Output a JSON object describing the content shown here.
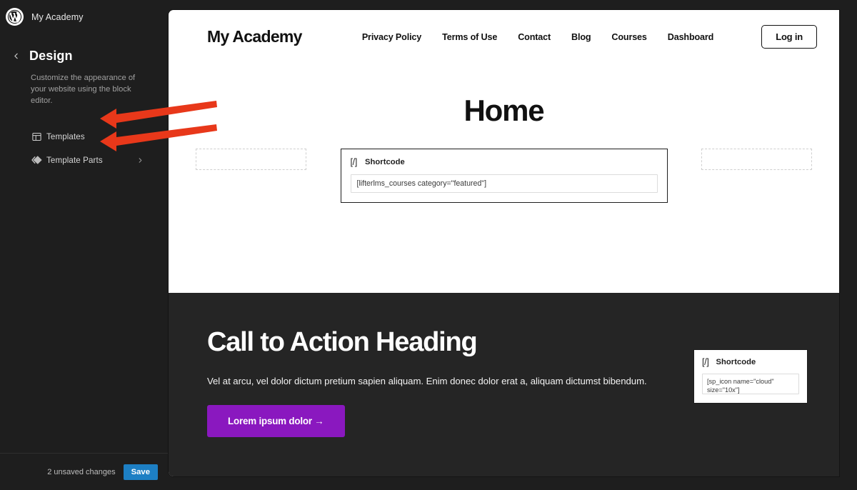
{
  "app": {
    "brand_icon": "wordpress-logo-icon",
    "site_name": "My Academy"
  },
  "sidebar": {
    "back_icon": "chevron-left-icon",
    "title": "Design",
    "description": "Customize the appearance of your website using the block editor.",
    "items": [
      {
        "label": "Templates",
        "icon": "template-layout-icon",
        "arrow": "chevron-right-icon"
      },
      {
        "label": "Template Parts",
        "icon": "template-parts-diamond-icon",
        "arrow": "chevron-right-icon"
      }
    ],
    "savebar": {
      "unsaved_text": "2 unsaved changes",
      "save_label": "Save"
    }
  },
  "canvas": {
    "header": {
      "logo": "My Academy",
      "nav": [
        {
          "label": "Privacy Policy"
        },
        {
          "label": "Terms of Use"
        },
        {
          "label": "Contact"
        },
        {
          "label": "Blog"
        },
        {
          "label": "Courses"
        },
        {
          "label": "Dashboard"
        }
      ],
      "login_label": "Log in"
    },
    "page_title": "Home",
    "shortcode_primary": {
      "glyph": "[/]",
      "title": "Shortcode",
      "value": "[lifterlms_courses category=\"featured\"]"
    },
    "cta": {
      "heading": "Call to Action Heading",
      "paragraph": "Vel at arcu, vel dolor dictum pretium sapien aliquam. Enim donec dolor erat a, aliquam dictumst bibendum.",
      "button_label": "Lorem ipsum dolor →"
    },
    "shortcode_secondary": {
      "glyph": "[/]",
      "title": "Shortcode",
      "value": "[sp_icon name=\"cloud\" size=\"10x\"]"
    }
  },
  "annotations": {
    "arrow_color": "#e8381a",
    "arrows": [
      {
        "name": "arrow-pointing-templates"
      },
      {
        "name": "arrow-pointing-template-parts"
      }
    ]
  },
  "colors": {
    "app_background": "#1e1e1e",
    "canvas_background": "#ffffff",
    "cta_background": "#252525",
    "cta_button": "#8a18bf",
    "save_button": "#1d7fc4",
    "annotation_red": "#e8381a"
  }
}
